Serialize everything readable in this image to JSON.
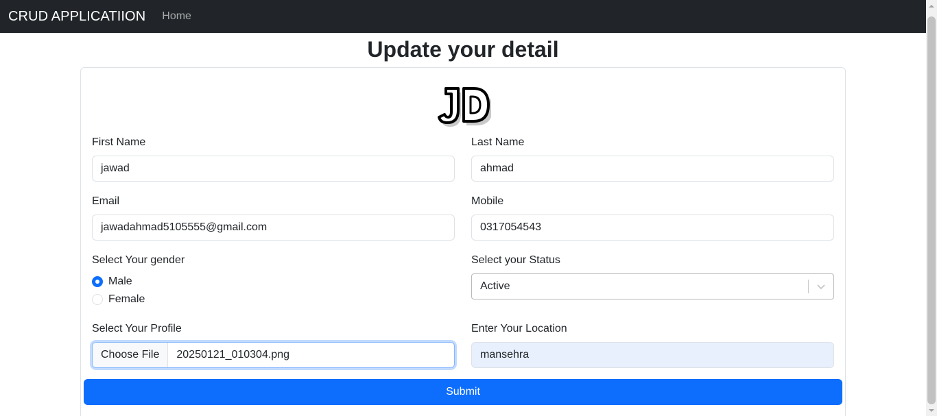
{
  "navbar": {
    "brand": "CRUD APPLICATIION",
    "home": "Home"
  },
  "page": {
    "title": "Update your detail"
  },
  "logo": {
    "text": "JD"
  },
  "form": {
    "first_name": {
      "label": "First Name",
      "value": "jawad"
    },
    "last_name": {
      "label": "Last Name",
      "value": "ahmad"
    },
    "email": {
      "label": "Email",
      "value": "jawadahmad5105555@gmail.com"
    },
    "mobile": {
      "label": "Mobile",
      "value": "0317054543"
    },
    "gender": {
      "label": "Select Your gender",
      "options": [
        "Male",
        "Female"
      ],
      "selected": "Male"
    },
    "status": {
      "label": "Select your Status",
      "value": "Active"
    },
    "profile": {
      "label": "Select Your Profile",
      "button": "Choose File",
      "file_name": "20250121_010304.png"
    },
    "location": {
      "label": "Enter Your Location",
      "value": "mansehra"
    },
    "submit": "Submit"
  },
  "colors": {
    "navbar_bg": "#212529",
    "primary": "#0d6efd",
    "autofill_bg": "#e8f0fe"
  }
}
